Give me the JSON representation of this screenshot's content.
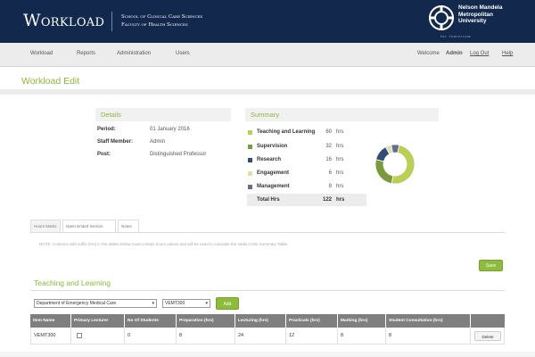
{
  "header": {
    "logo": "Workload",
    "school": "School of Clinical Care Sciences",
    "faculty": "Faculty of Health Sciences",
    "university_lines": [
      "Nelson Mandela",
      "Metropolitan",
      "University"
    ],
    "tagline": "for tomorrow"
  },
  "nav": {
    "items": [
      "Workload",
      "Reports",
      "Administration",
      "Users"
    ],
    "welcome": "Welcome",
    "user": "Admin",
    "logout": "Log Out",
    "help": "Help"
  },
  "page_title": "Workload Edit",
  "details": {
    "title": "Details",
    "rows": [
      {
        "label": "Period:",
        "value": "01 January 2016"
      },
      {
        "label": "Staff Member:",
        "value": "Admin"
      },
      {
        "label": "Post:",
        "value": "Distinguished Professor"
      }
    ]
  },
  "summary": {
    "title": "Summary",
    "unit": "hrs",
    "rows": [
      {
        "label": "Teaching and Learning",
        "value": "60",
        "color": "#b9cf57"
      },
      {
        "label": "Supervision",
        "value": "32",
        "color": "#7a9a3c"
      },
      {
        "label": "Research",
        "value": "16",
        "color": "#2f4d75"
      },
      {
        "label": "Engagement",
        "value": "6",
        "color": "#d6e3aa"
      },
      {
        "label": "Management",
        "value": "8",
        "color": "#6a6a8c"
      }
    ],
    "total_label": "Total Hrs",
    "total_value": "122"
  },
  "chart_data": {
    "type": "pie",
    "categories": [
      "Teaching and Learning",
      "Supervision",
      "Research",
      "Engagement",
      "Management"
    ],
    "values": [
      60,
      32,
      16,
      6,
      8
    ],
    "colors": [
      "#b9cf57",
      "#7a9a3c",
      "#2f4d75",
      "#d6e3aa",
      "#6a6a8c"
    ],
    "donut": true
  },
  "tabs": [
    "Hours Matrix",
    "Open Ended Section",
    "Notes"
  ],
  "note": "NOTE: Columns with suffix (hrs) in the tables below must contain hours values and will be used to calculate the totals in the Summary Table.",
  "save_label": "Save",
  "section": {
    "title": "Teaching and Learning",
    "department": "Department of Emergency Medical Care",
    "module": "VEMT300",
    "add_label": "Add"
  },
  "table": {
    "headers": [
      "Item Name",
      "Primary Lecturer",
      "No Of Students",
      "Preparation (hrs)",
      "Lecturing (hrs)",
      "Practicals (hrs)",
      "Marking (hrs)",
      "Student Consultation (hrs)",
      ""
    ],
    "row": {
      "item_name": "VEMT300",
      "students": "0",
      "preparation": "8",
      "lecturing": "24",
      "practicals": "12",
      "marking": "8",
      "consultation": "8",
      "delete_label": "Delete"
    }
  }
}
